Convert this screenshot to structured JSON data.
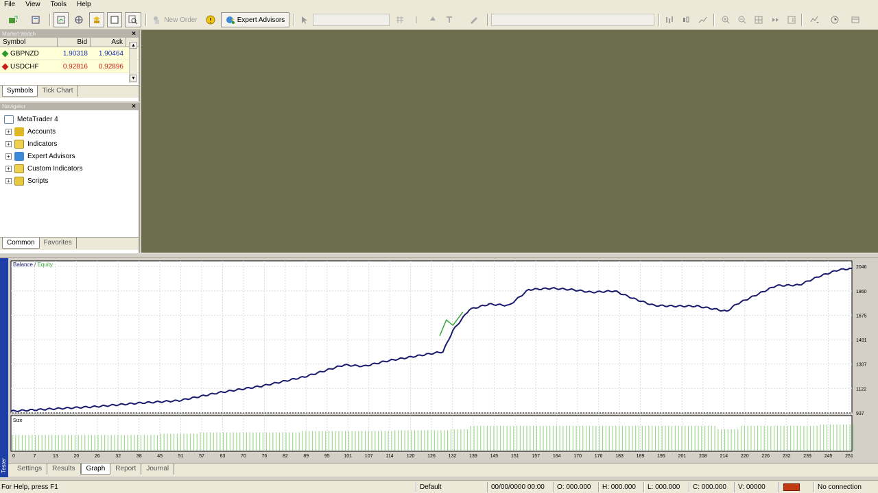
{
  "menu": [
    "File",
    "View",
    "Tools",
    "Help"
  ],
  "toolbar": {
    "new_order": "New Order",
    "expert_advisors": "Expert Advisors"
  },
  "market_watch": {
    "title": "Market Watch",
    "columns": [
      "Symbol",
      "Bid",
      "Ask"
    ],
    "rows": [
      {
        "symbol": "GBPNZD",
        "bid": "1.90318",
        "ask": "1.90464",
        "color": "#2a9a2a"
      },
      {
        "symbol": "USDCHF",
        "bid": "0.92816",
        "ask": "0.92896",
        "color": "#c8201a"
      }
    ],
    "tabs": [
      "Symbols",
      "Tick Chart"
    ]
  },
  "navigator": {
    "title": "Navigator",
    "root": "MetaTrader 4",
    "items": [
      "Accounts",
      "Indicators",
      "Expert Advisors",
      "Custom Indicators",
      "Scripts"
    ],
    "tabs": [
      "Common",
      "Favorites"
    ]
  },
  "tester": {
    "side_label": "Tester",
    "tabs": [
      "Settings",
      "Results",
      "Graph",
      "Report",
      "Journal"
    ],
    "active_tab": "Graph"
  },
  "chart_data": {
    "type": "line",
    "legend": [
      "Balance",
      "Equity"
    ],
    "colors": {
      "balance": "#1a1a6e",
      "equity": "#3aa63a",
      "size": "#9fd88f"
    },
    "ylim": [
      937,
      2046
    ],
    "y_ticks": [
      "2046",
      "1860",
      "1675",
      "1491",
      "1307",
      "1122",
      "937"
    ],
    "x_ticks": [
      "0",
      "7",
      "13",
      "20",
      "26",
      "32",
      "38",
      "45",
      "51",
      "57",
      "63",
      "70",
      "76",
      "82",
      "89",
      "95",
      "101",
      "107",
      "114",
      "120",
      "126",
      "132",
      "139",
      "145",
      "151",
      "157",
      "164",
      "170",
      "176",
      "183",
      "189",
      "195",
      "201",
      "208",
      "214",
      "220",
      "226",
      "232",
      "239",
      "245",
      "251"
    ],
    "balance": [
      [
        0,
        950
      ],
      [
        13,
        968
      ],
      [
        26,
        985
      ],
      [
        38,
        1010
      ],
      [
        51,
        1030
      ],
      [
        63,
        1090
      ],
      [
        76,
        1140
      ],
      [
        89,
        1210
      ],
      [
        101,
        1300
      ],
      [
        107,
        1290
      ],
      [
        114,
        1330
      ],
      [
        126,
        1380
      ],
      [
        131,
        1400
      ],
      [
        134,
        1560
      ],
      [
        139,
        1720
      ],
      [
        145,
        1760
      ],
      [
        151,
        1750
      ],
      [
        157,
        1870
      ],
      [
        164,
        1880
      ],
      [
        170,
        1870
      ],
      [
        176,
        1850
      ],
      [
        183,
        1860
      ],
      [
        189,
        1800
      ],
      [
        195,
        1750
      ],
      [
        201,
        1745
      ],
      [
        208,
        1745
      ],
      [
        214,
        1720
      ],
      [
        217,
        1705
      ],
      [
        220,
        1760
      ],
      [
        226,
        1830
      ],
      [
        232,
        1900
      ],
      [
        239,
        1905
      ],
      [
        245,
        1970
      ],
      [
        251,
        2020
      ],
      [
        255,
        2030
      ]
    ],
    "equity_spike": [
      [
        130,
        1520
      ],
      [
        132,
        1640
      ],
      [
        134,
        1600
      ],
      [
        137,
        1700
      ]
    ],
    "size_label": "Size",
    "size_levels": [
      [
        0,
        0.6
      ],
      [
        45,
        0.65
      ],
      [
        57,
        0.7
      ],
      [
        88,
        0.75
      ],
      [
        116,
        0.78
      ],
      [
        133,
        0.82
      ],
      [
        139,
        0.95
      ],
      [
        200,
        0.95
      ],
      [
        214,
        0.82
      ],
      [
        221,
        0.95
      ],
      [
        245,
        1.0
      ],
      [
        255,
        1.0
      ]
    ]
  },
  "status": {
    "help": "For Help, press F1",
    "profile": "Default",
    "datetime": "00/00/0000 00:00",
    "open": "O: 000.000",
    "high": "H: 000.000",
    "low": "L: 000.000",
    "close": "C: 000.000",
    "volume": "V: 00000",
    "connection": "No connection"
  }
}
